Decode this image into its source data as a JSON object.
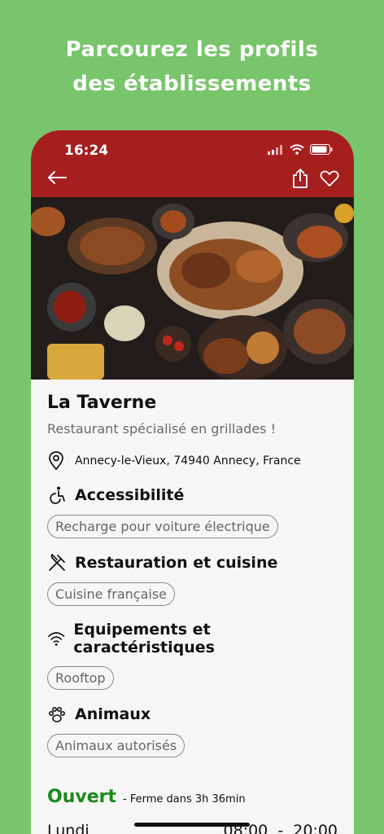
{
  "headline": {
    "line1": "Parcourez les profils",
    "line2": "des établissements"
  },
  "status_bar": {
    "time": "16:24"
  },
  "restaurant": {
    "name": "La Taverne",
    "tagline": "Restaurant spécialisé en grillades !",
    "address": "Annecy-le-Vieux, 74940 Annecy, France"
  },
  "sections": [
    {
      "title": "Accessibilité",
      "icon": "wheelchair-icon",
      "chips": [
        "Recharge pour voiture électrique"
      ]
    },
    {
      "title": "Restauration et cuisine",
      "icon": "fork-knife-icon",
      "chips": [
        "Cuisine française"
      ]
    },
    {
      "title": "Equipements et caractéristiques",
      "icon": "wifi-icon",
      "chips": [
        "Rooftop"
      ]
    },
    {
      "title": "Animaux",
      "icon": "paw-icon",
      "chips": [
        "Animaux autorisés"
      ]
    }
  ],
  "opening": {
    "status": "Ouvert",
    "note": "- Ferme dans 3h 36min",
    "hours": [
      {
        "day": "Lundi",
        "open": "08:00",
        "sep": "-",
        "close": "20:00"
      }
    ]
  },
  "colors": {
    "background": "#78c56b",
    "topbar": "#a51f1f",
    "open_green": "#1b8a1b"
  }
}
